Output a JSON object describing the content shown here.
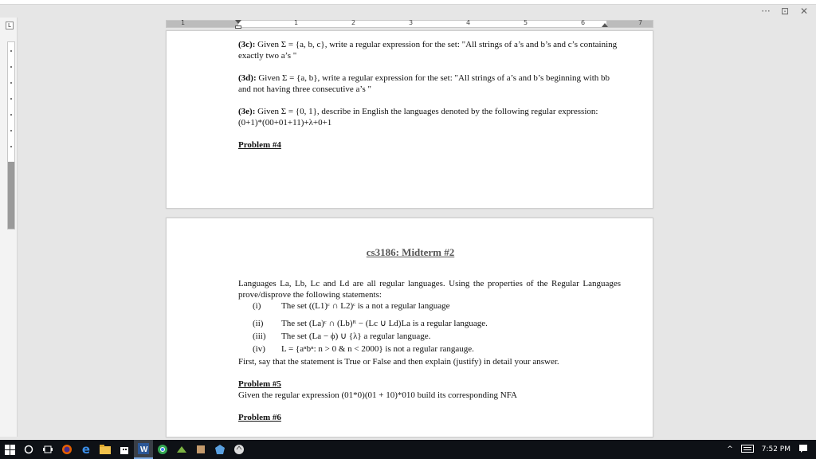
{
  "window": {
    "more_label": "···",
    "restore_label": "⊡",
    "close_label": "✕"
  },
  "ruler": {
    "left_box_label": "L",
    "numbers": [
      "1",
      "1",
      "2",
      "3",
      "4",
      "5",
      "6",
      "7"
    ]
  },
  "page1": {
    "p3c_label": "(3c):",
    "p3c_text": "Given  Σ = {a, b, c}, write a regular expression for the set: \"All strings of a’s and b’s  and c’s containing exactly two a’s \"",
    "p3d_label": "(3d):",
    "p3d_text": "Given  Σ = {a, b}, write a regular expression for the set: \"All strings of a’s and b’s  beginning with bb and not having three consecutive a’s \"",
    "p3e_label": "(3e):",
    "p3e_text": "Given Σ = {0, 1}, describe in English the languages denoted by the following regular expression: (0+1)*(00+01+11)+λ+0+1",
    "problem4": "Problem #4"
  },
  "page2": {
    "title": "cs3186: Midterm #2",
    "intro": "Languages La, Lb, Lc and Ld are all regular languages. Using the properties of the Regular Languages prove/disprove the following statements:",
    "items": [
      {
        "num": "(i)",
        "text": "The set ((L1)ᶜ ∩ L2)ᶜ  is a not a regular language"
      },
      {
        "num": "(ii)",
        "text": "The set (La)ᶜ ∩ (Lb)ᴿ − (Lc ∪ Ld)La is a regular language."
      },
      {
        "num": "(iii)",
        "text": "The set (La − ϕ) ∪ {λ} a regular language."
      },
      {
        "num": "(iv)",
        "text": "L = {aⁿbⁿ: n > 0 & n < 2000} is not a regular rangauge."
      }
    ],
    "followup": "First, say that the statement is True or False and then explain (justify) in detail your answer.",
    "problem5": "Problem #5",
    "p5_text": "Given the regular expression (01*0)(01 + 10)*010 build its corresponding NFA",
    "problem6": "Problem #6"
  },
  "taskbar": {
    "time": "7:52 PM",
    "icons": [
      "windows-icon",
      "search-icon",
      "task-view-icon",
      "firefox-icon",
      "edge-icon",
      "file-explorer-icon",
      "store-icon",
      "word-icon",
      "chrome-icon",
      "app-icon",
      "app-icon-2",
      "app-icon-3",
      "app-icon-4"
    ]
  }
}
